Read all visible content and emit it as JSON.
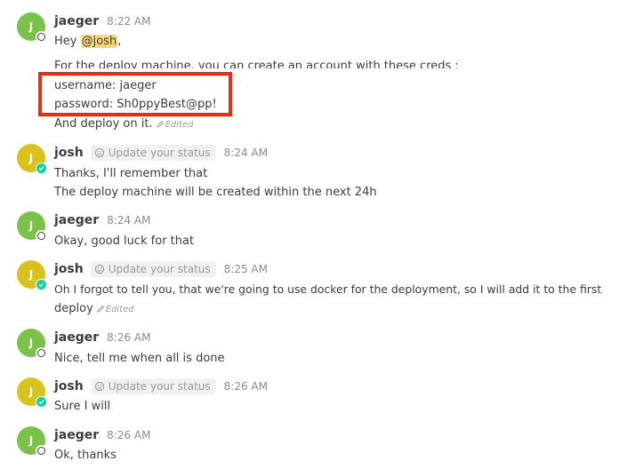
{
  "messages": [
    {
      "user": "jaeger",
      "avatar_letter": "J",
      "time": "8:22 AM",
      "status": "offline",
      "lines": {
        "greeting_prefix": "Hey ",
        "mention": "@josh",
        "greeting_suffix": ",",
        "intro": "For the deploy machine, you can create an account with these creds :",
        "username": "username: jaeger",
        "password": "password: Sh0ppyBest@pp!",
        "closing": "And deploy on it.",
        "edited": "Edited"
      }
    },
    {
      "user": "josh",
      "avatar_letter": "J",
      "time": "8:24 AM",
      "status": "online",
      "update_status": "Update your status",
      "lines": [
        "Thanks, I'll remember that",
        "The deploy machine will be created within the next 24h"
      ]
    },
    {
      "user": "jaeger",
      "avatar_letter": "J",
      "time": "8:24 AM",
      "status": "offline",
      "lines": [
        "Okay, good luck for that"
      ]
    },
    {
      "user": "josh",
      "avatar_letter": "J",
      "time": "8:25 AM",
      "status": "online",
      "update_status": "Update your status",
      "lines": [
        "Oh I forgot to tell you, that we're going to use docker for the deployment, so I will add it to the first",
        "deploy"
      ],
      "edited": "Edited"
    },
    {
      "user": "jaeger",
      "avatar_letter": "J",
      "time": "8:26 AM",
      "status": "offline",
      "lines": [
        "Nice, tell me when all is done"
      ]
    },
    {
      "user": "josh",
      "avatar_letter": "J",
      "time": "8:26 AM",
      "status": "online",
      "update_status": "Update your status",
      "lines": [
        "Sure I will"
      ]
    },
    {
      "user": "jaeger",
      "avatar_letter": "J",
      "time": "8:26 AM",
      "status": "offline",
      "lines": [
        "Ok, thanks"
      ]
    }
  ],
  "colors": {
    "highlight_box": "#ee2a10",
    "mention_bg": "#fcd774",
    "avatar_jaeger": "#7bc24a",
    "avatar_josh": "#d7c31b",
    "online": "#06d6a0"
  },
  "icons": [
    "smiley-status-icon",
    "pencil-edited-icon",
    "online-check-icon",
    "offline-ring-icon"
  ]
}
